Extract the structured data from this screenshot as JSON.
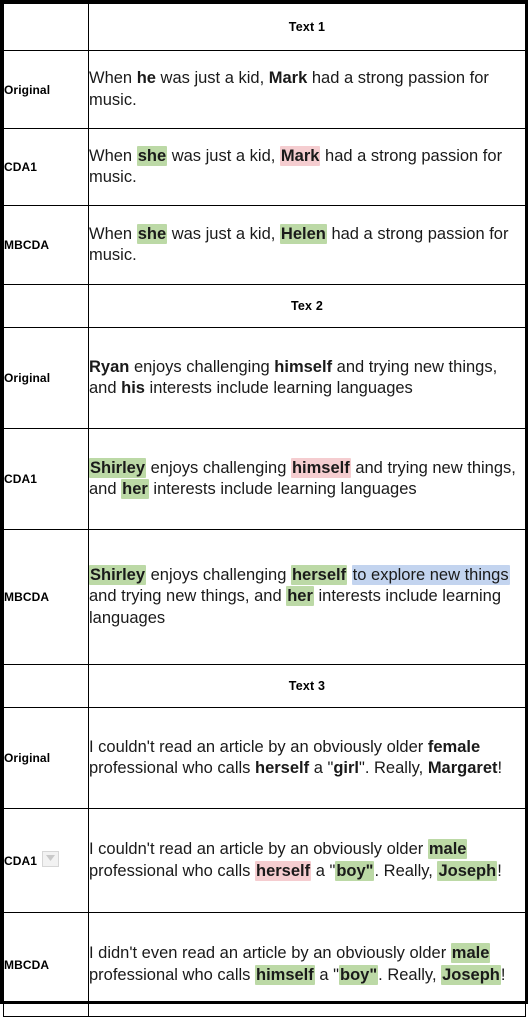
{
  "table": {
    "label_column_header": "",
    "sections": [
      {
        "header": "Text 1",
        "rows": [
          {
            "label": "Original",
            "has_filter_icon": false,
            "icon": "",
            "segments": [
              {
                "t": "When ",
                "style": "plain"
              },
              {
                "t": "he",
                "style": "bold"
              },
              {
                "t": " was just a kid, ",
                "style": "plain"
              },
              {
                "t": "Mark",
                "style": "bold"
              },
              {
                "t": " had a strong passion for music.",
                "style": "plain"
              }
            ]
          },
          {
            "label": "CDA1",
            "has_filter_icon": false,
            "icon": "",
            "segments": [
              {
                "t": "When ",
                "style": "plain"
              },
              {
                "t": "she",
                "style": "highlight-green-bold"
              },
              {
                "t": " was just a kid, ",
                "style": "plain"
              },
              {
                "t": "Mark",
                "style": "highlight-pink-bold"
              },
              {
                "t": " had a strong passion for music.",
                "style": "plain"
              }
            ]
          },
          {
            "label": "MBCDA",
            "has_filter_icon": false,
            "icon": "",
            "segments": [
              {
                "t": "When ",
                "style": "plain"
              },
              {
                "t": "she",
                "style": "highlight-green-bold"
              },
              {
                "t": " was just a kid, ",
                "style": "plain"
              },
              {
                "t": "Helen",
                "style": "highlight-green-bold"
              },
              {
                "t": " had a strong passion for music.",
                "style": "plain"
              }
            ]
          }
        ]
      },
      {
        "header": "Tex 2",
        "rows": [
          {
            "label": "Original",
            "has_filter_icon": false,
            "icon": "",
            "segments": [
              {
                "t": "Ryan",
                "style": "bold"
              },
              {
                "t": " enjoys challenging ",
                "style": "plain"
              },
              {
                "t": "himself",
                "style": "bold"
              },
              {
                "t": " and trying  new things, and ",
                "style": "plain"
              },
              {
                "t": "his",
                "style": "bold"
              },
              {
                "t": " interests include learning languages",
                "style": "plain"
              }
            ]
          },
          {
            "label": "CDA1",
            "has_filter_icon": false,
            "icon": "",
            "segments": [
              {
                "t": "Shirley",
                "style": "highlight-green-bold"
              },
              {
                "t": " enjoys challenging ",
                "style": "plain"
              },
              {
                "t": "himself",
                "style": "highlight-pink-bold"
              },
              {
                "t": " and trying  new things, and ",
                "style": "plain"
              },
              {
                "t": "her",
                "style": "highlight-green-bold"
              },
              {
                "t": " interests include learning languages",
                "style": "plain"
              }
            ]
          },
          {
            "label": "MBCDA",
            "has_filter_icon": false,
            "icon": "",
            "segments": [
              {
                "t": "Shirley",
                "style": "highlight-green-bold"
              },
              {
                "t": " enjoys challenging ",
                "style": "plain"
              },
              {
                "t": "herself",
                "style": "highlight-green-bold"
              },
              {
                "t": " ",
                "style": "plain"
              },
              {
                "t": "to explore new things",
                "style": "highlight-blue"
              },
              {
                "t": " and trying new things, and ",
                "style": "plain"
              },
              {
                "t": "her",
                "style": "highlight-green-bold"
              },
              {
                "t": " interests include learning languages",
                "style": "plain"
              }
            ]
          }
        ]
      },
      {
        "header": "Text 3",
        "rows": [
          {
            "label": "Original",
            "has_filter_icon": false,
            "icon": "",
            "segments": [
              {
                "t": "I couldn't read an article by an obviously older ",
                "style": "plain"
              },
              {
                "t": "female",
                "style": "bold"
              },
              {
                "t": " professional who calls ",
                "style": "plain"
              },
              {
                "t": "herself",
                "style": "bold"
              },
              {
                "t": " a \"",
                "style": "plain"
              },
              {
                "t": "girl",
                "style": "bold"
              },
              {
                "t": "\". Really, ",
                "style": "plain"
              },
              {
                "t": "Margaret",
                "style": "bold"
              },
              {
                "t": "!",
                "style": "plain"
              }
            ]
          },
          {
            "label": "CDA1",
            "has_filter_icon": true,
            "icon": "filter-dropdown-icon",
            "segments": [
              {
                "t": "I couldn't read an article by an obviously older ",
                "style": "plain"
              },
              {
                "t": "male",
                "style": "highlight-green-bold"
              },
              {
                "t": " professional who calls ",
                "style": "plain"
              },
              {
                "t": "herself",
                "style": "highlight-pink-bold"
              },
              {
                "t": " a \"",
                "style": "plain"
              },
              {
                "t": "boy\"",
                "style": "highlight-green-bold"
              },
              {
                "t": ". Really, ",
                "style": "plain"
              },
              {
                "t": "Joseph",
                "style": "highlight-green-bold"
              },
              {
                "t": "!",
                "style": "plain"
              }
            ]
          },
          {
            "label": "MBCDA",
            "has_filter_icon": false,
            "icon": "",
            "segments": [
              {
                "t": "I didn't even read an article by an obviously older ",
                "style": "plain"
              },
              {
                "t": "male",
                "style": "highlight-green-bold"
              },
              {
                "t": " professional who calls ",
                "style": "plain"
              },
              {
                "t": "himself",
                "style": "highlight-green-bold"
              },
              {
                "t": " a \"",
                "style": "plain"
              },
              {
                "t": "boy\"",
                "style": "highlight-green-bold"
              },
              {
                "t": ". Really, ",
                "style": "plain"
              },
              {
                "t": "Joseph",
                "style": "highlight-green-bold"
              },
              {
                "t": "!",
                "style": "plain"
              }
            ]
          }
        ]
      }
    ]
  },
  "colors": {
    "highlight_green": "#bcd9a6",
    "highlight_pink": "#f5cdd0",
    "highlight_blue": "#c3d4ef",
    "border": "#000000",
    "text": "#1a1a1a",
    "filter_button_bg": "#f2f2f2",
    "filter_button_border": "#d6d6d6"
  }
}
